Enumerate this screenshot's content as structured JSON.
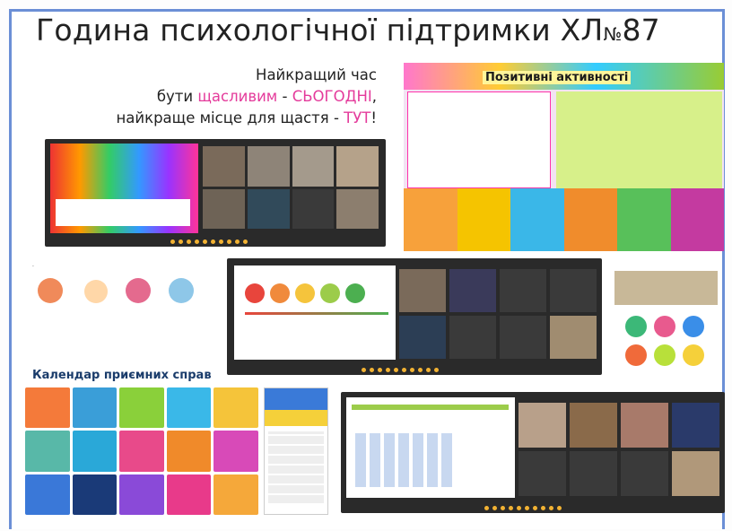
{
  "title": {
    "main": "Година психологічної підтримки ХЛ",
    "num_sign": "№",
    "number": "87"
  },
  "quote": {
    "line1": "Найкращий час",
    "line2_a": "бути ",
    "line2_b": "щасливим",
    "line2_c": " - ",
    "line2_d": "СЬОГОДНІ",
    "line2_e": ",",
    "line3_a": "найкраще місце для щастя - ",
    "line3_b": "ТУТ",
    "line3_c": "!"
  },
  "positive_title": "Позитивні активності",
  "calendar_title": "Календар приємних справ",
  "colors": {
    "frame": "#6b8fd6",
    "panel": "#2a2a2a",
    "accent_pink": "#e43b9b"
  }
}
